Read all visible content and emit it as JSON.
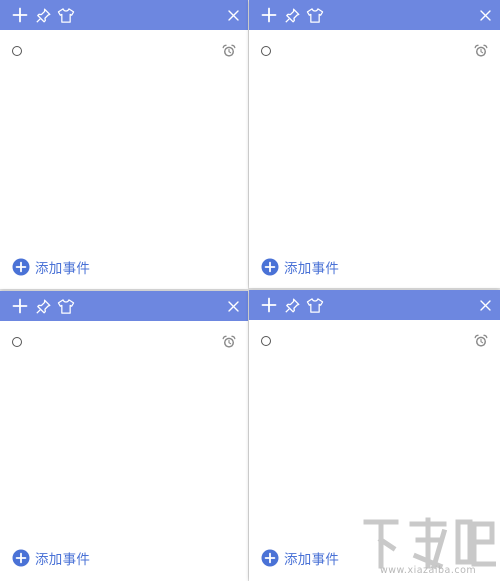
{
  "theme": {
    "header_color": "#6d87e0",
    "accent_color": "#4a72d6",
    "icon_color": "#ffffff"
  },
  "notes": [
    {
      "id": "top-left",
      "header": {
        "add_icon": "plus-icon",
        "pin_icon": "pin-icon",
        "skin_icon": "tshirt-icon",
        "close_icon": "close-icon"
      },
      "task": {
        "checkbox": "empty-circle",
        "alarm_icon": "alarm-clock-icon",
        "value": ""
      },
      "add_event_label": "添加事件"
    },
    {
      "id": "top-right",
      "header": {
        "add_icon": "plus-icon",
        "pin_icon": "pin-icon",
        "skin_icon": "tshirt-icon",
        "close_icon": "close-icon"
      },
      "task": {
        "checkbox": "empty-circle",
        "alarm_icon": "alarm-clock-icon",
        "value": ""
      },
      "add_event_label": "添加事件"
    },
    {
      "id": "bottom-left",
      "header": {
        "add_icon": "plus-icon",
        "pin_icon": "pin-icon",
        "skin_icon": "tshirt-icon",
        "close_icon": "close-icon"
      },
      "task": {
        "checkbox": "empty-circle",
        "alarm_icon": "alarm-clock-icon",
        "value": ""
      },
      "add_event_label": "添加事件"
    },
    {
      "id": "bottom-right",
      "header": {
        "add_icon": "plus-icon",
        "pin_icon": "pin-icon",
        "skin_icon": "tshirt-icon",
        "close_icon": "close-icon"
      },
      "task": {
        "checkbox": "empty-circle",
        "alarm_icon": "alarm-clock-icon",
        "value": ""
      },
      "add_event_label": "添加事件"
    }
  ],
  "watermark": {
    "logo_text": "下载吧",
    "site_text": "www.xiazaiba.com"
  }
}
